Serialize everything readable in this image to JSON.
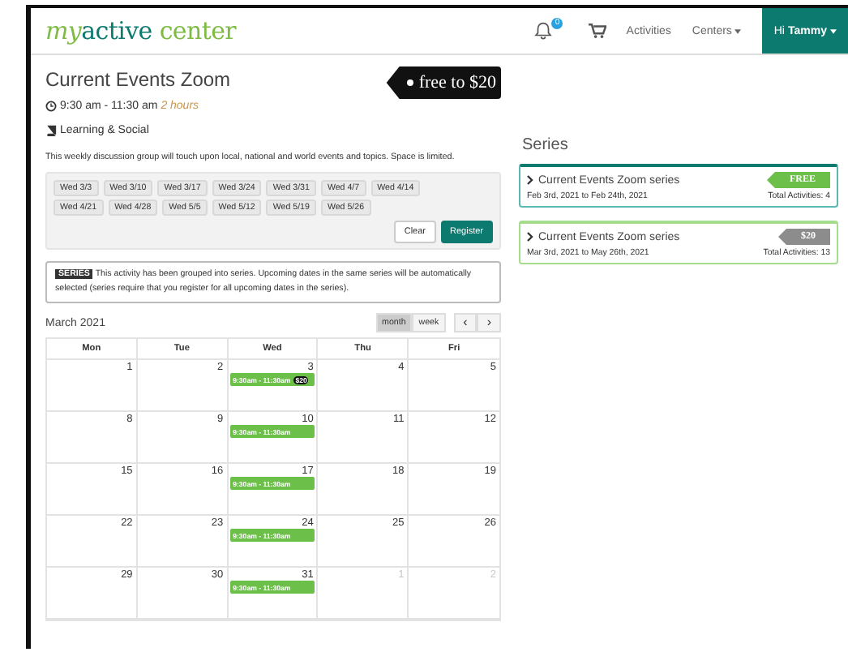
{
  "header": {
    "logo": {
      "part1": "my",
      "part2": "active",
      "part3": "center"
    },
    "notification_count": "0",
    "nav": [
      "Activities",
      "Centers"
    ],
    "user": {
      "greeting": "Hi",
      "name": "Tammy"
    }
  },
  "event": {
    "title": "Current Events Zoom",
    "price_tag": "free to $20",
    "time": "9:30 am - 11:30 am",
    "duration": "2 hours",
    "category": "Learning & Social",
    "description": "This weekly discussion group will touch upon local, national and world events and topics. Space is limited."
  },
  "dates": [
    "Wed 3/3",
    "Wed 3/10",
    "Wed 3/17",
    "Wed 3/24",
    "Wed 3/31",
    "Wed 4/7",
    "Wed 4/14",
    "Wed 4/21",
    "Wed 4/28",
    "Wed 5/5",
    "Wed 5/12",
    "Wed 5/19",
    "Wed 5/26"
  ],
  "buttons": [
    "Clear",
    "Register"
  ],
  "series_note": {
    "badge": "SERIES",
    "text": "This activity has been grouped into series. Upcoming dates in the same series will be automatically selected (series require that you register for all upcoming dates in the series)."
  },
  "calendar": {
    "title": "March 2021",
    "views": [
      {
        "label": "month",
        "selected": true
      },
      {
        "label": "week",
        "selected": false
      }
    ],
    "prev": "‹",
    "next": "›",
    "columns": [
      "Mon",
      "Tue",
      "Wed",
      "Thu",
      "Fri"
    ],
    "weeks": [
      [
        {
          "day": "1",
          "other_month": false
        },
        {
          "day": "2",
          "other_month": false
        },
        {
          "day": "3",
          "other_month": false,
          "events": [
            {
              "time": "9:30am - 11:30am",
              "badge": "$20"
            }
          ]
        },
        {
          "day": "4",
          "other_month": false
        },
        {
          "day": "5",
          "other_month": false
        }
      ],
      [
        {
          "day": "8",
          "other_month": false
        },
        {
          "day": "9",
          "other_month": false
        },
        {
          "day": "10",
          "other_month": false,
          "events": [
            {
              "time": "9:30am - 11:30am"
            }
          ]
        },
        {
          "day": "11",
          "other_month": false
        },
        {
          "day": "12",
          "other_month": false
        }
      ],
      [
        {
          "day": "15",
          "other_month": false
        },
        {
          "day": "16",
          "other_month": false
        },
        {
          "day": "17",
          "other_month": false,
          "events": [
            {
              "time": "9:30am - 11:30am"
            }
          ]
        },
        {
          "day": "18",
          "other_month": false
        },
        {
          "day": "19",
          "other_month": false
        }
      ],
      [
        {
          "day": "22",
          "other_month": false
        },
        {
          "day": "23",
          "other_month": false
        },
        {
          "day": "24",
          "other_month": false,
          "events": [
            {
              "time": "9:30am - 11:30am"
            }
          ]
        },
        {
          "day": "25",
          "other_month": false
        },
        {
          "day": "26",
          "other_month": false
        }
      ],
      [
        {
          "day": "29",
          "other_month": false
        },
        {
          "day": "30",
          "other_month": false
        },
        {
          "day": "31",
          "other_month": false,
          "events": [
            {
              "time": "9:30am - 11:30am"
            }
          ]
        },
        {
          "day": "1",
          "other_month": true
        },
        {
          "day": "2",
          "other_month": true
        }
      ]
    ]
  },
  "series": {
    "title": "Series",
    "items": [
      {
        "name": "Current Events Zoom series",
        "price": "FREE",
        "range": "Feb 3rd, 2021 to Feb 24th, 2021",
        "total": "Total Activities: 4",
        "kind": "free"
      },
      {
        "name": "Current Events Zoom series",
        "price": "$20",
        "range": "Mar 3rd, 2021 to May 26th, 2021",
        "total": "Total Activities: 13",
        "kind": "paid"
      }
    ]
  }
}
